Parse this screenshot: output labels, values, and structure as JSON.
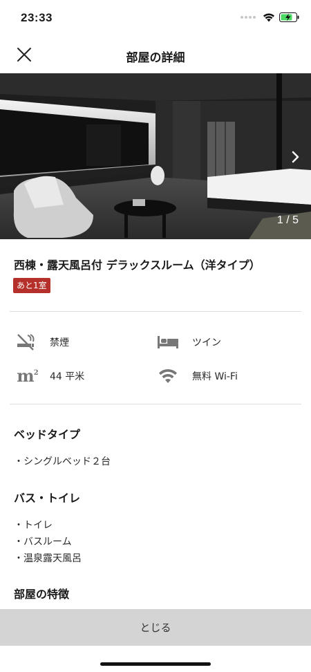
{
  "status_bar": {
    "time": "23:33"
  },
  "header": {
    "title": "部屋の詳細"
  },
  "photo": {
    "counter": "1 / 5",
    "current": 1,
    "total": 5
  },
  "room": {
    "name": "西棟・露天風呂付 デラックスルーム（洋タイプ）",
    "availability": "あと1室"
  },
  "amenities": [
    {
      "icon": "no-smoking-icon",
      "label": "禁煙"
    },
    {
      "icon": "bed-icon",
      "label": "ツイン"
    },
    {
      "icon": "square-meter-icon",
      "icon_text": "m",
      "icon_sup": "2",
      "label": "44 平米"
    },
    {
      "icon": "wifi-icon",
      "label": "無料 Wi-Fi"
    }
  ],
  "sections": {
    "bed_type": {
      "title": "ベッドタイプ",
      "items": [
        "・シングルベッド２台"
      ]
    },
    "bath_toilet": {
      "title": "バス・トイレ",
      "items": [
        "・トイレ",
        "・バスルーム",
        "・温泉露天風呂"
      ]
    },
    "features": {
      "title": "部屋の特徴"
    }
  },
  "footer": {
    "close_label": "とじる"
  },
  "colors": {
    "badge": "#b5302a",
    "footer_bg": "#d4d4d4"
  }
}
